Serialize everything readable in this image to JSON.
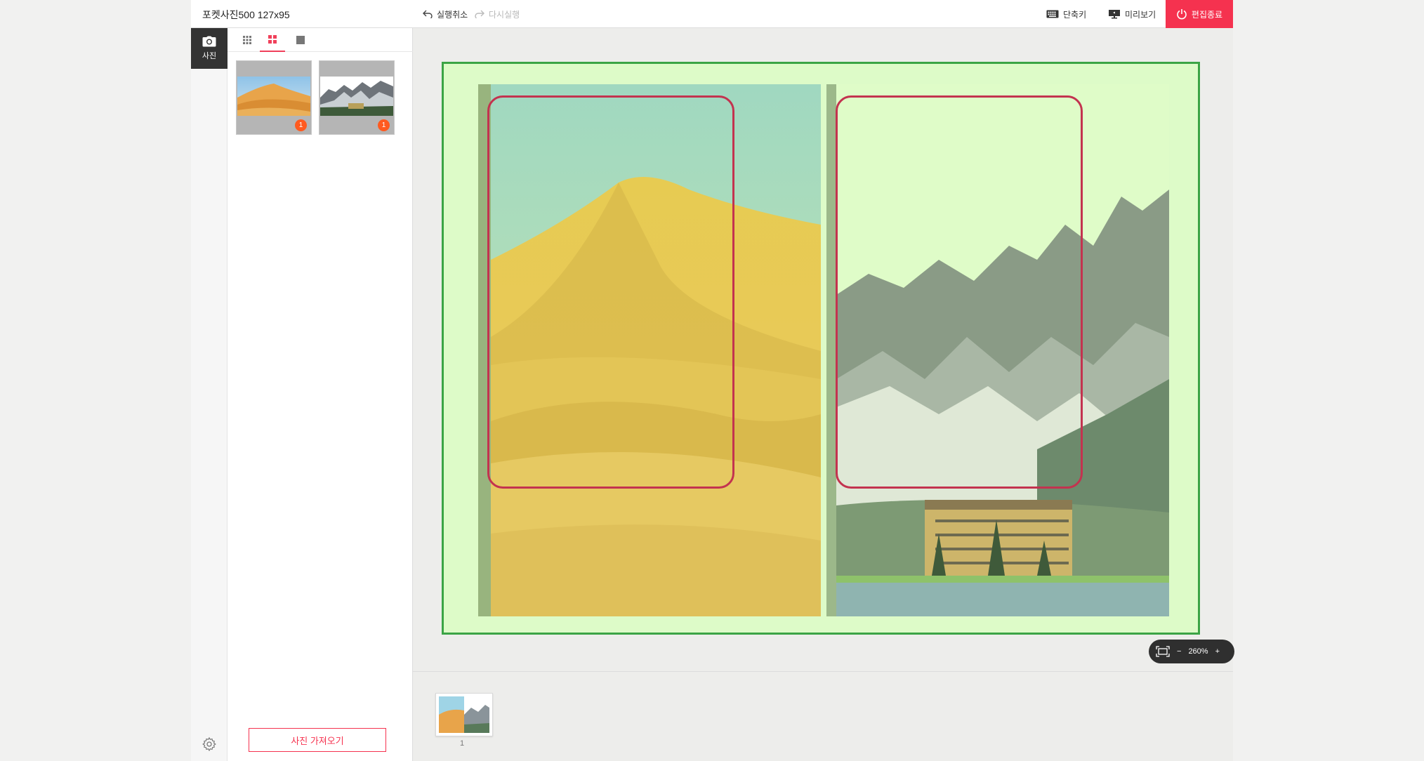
{
  "header": {
    "product_title": "포켓사진500 127x95",
    "undo_label": "실행취소",
    "redo_label": "다시실행",
    "shortcut_label": "단축키",
    "preview_label": "미리보기",
    "finish_label": "편집종료"
  },
  "rail": {
    "photo_label": "사진"
  },
  "panel": {
    "view_modes": [
      "grid-small-icon",
      "grid-large-icon",
      "single-icon"
    ],
    "active_view": 1,
    "thumbnails": [
      {
        "subject": "desert",
        "badge": "1"
      },
      {
        "subject": "mountains",
        "badge": "1"
      }
    ],
    "import_label": "사진 가져오기"
  },
  "zoom": {
    "value": "260%",
    "minus": "−",
    "plus": "+"
  },
  "pages": {
    "page_number": "1"
  },
  "colors": {
    "accent": "#f5324f",
    "page_bg": "#ddfbc8",
    "page_border": "#3ba445",
    "frame": "#c3334f",
    "badge": "#ff5a1f"
  }
}
